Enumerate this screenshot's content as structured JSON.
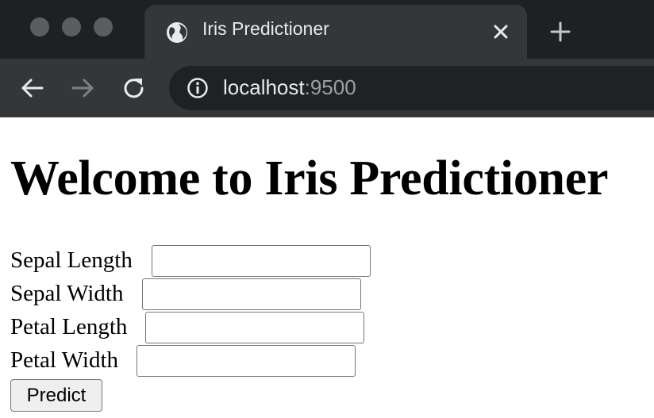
{
  "browser": {
    "tab": {
      "title": "Iris Predictioner",
      "icon": "globe-icon"
    },
    "address": {
      "host": "localhost",
      "port": ":9500"
    },
    "colors": {
      "tabbar": "#1f2023",
      "toolbar": "#35363a",
      "omnibox": "#202124"
    }
  },
  "page": {
    "heading": "Welcome to Iris Predictioner",
    "form": {
      "fields": [
        {
          "label": "Sepal Length",
          "value": ""
        },
        {
          "label": "Sepal Width",
          "value": ""
        },
        {
          "label": "Petal Length",
          "value": ""
        },
        {
          "label": "Petal Width",
          "value": ""
        }
      ],
      "submit_label": "Predict"
    }
  }
}
